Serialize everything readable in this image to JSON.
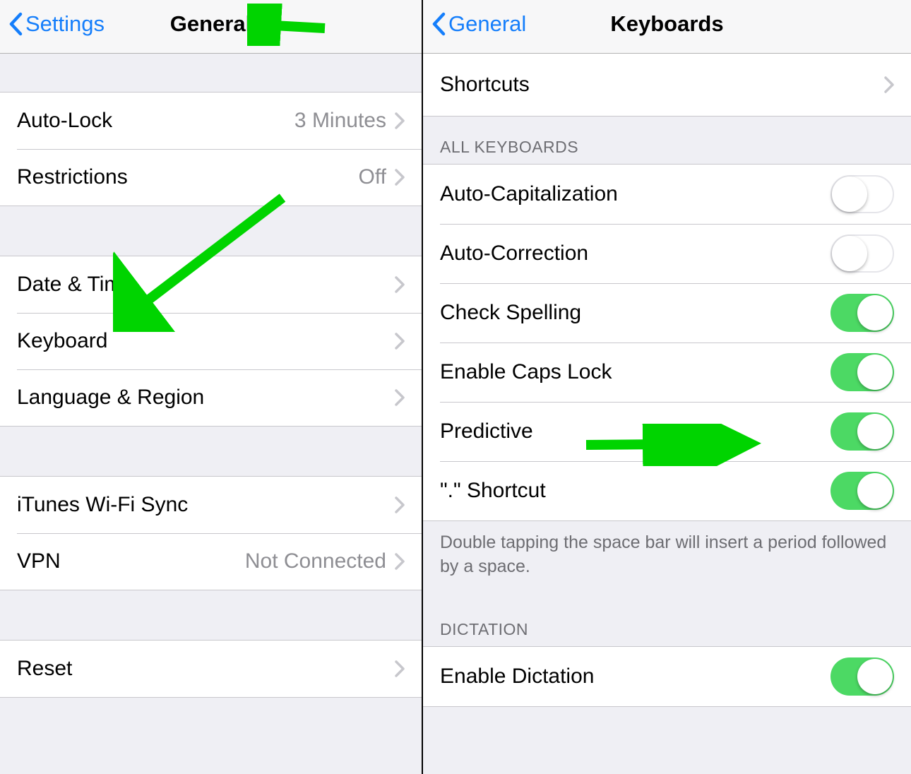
{
  "left": {
    "back_label": "Settings",
    "title": "General",
    "group1": {
      "auto_lock": {
        "label": "Auto-Lock",
        "value": "3 Minutes"
      },
      "restrictions": {
        "label": "Restrictions",
        "value": "Off"
      }
    },
    "group2": {
      "date_time": {
        "label": "Date & Time"
      },
      "keyboard": {
        "label": "Keyboard"
      },
      "language_region": {
        "label": "Language & Region"
      }
    },
    "group3": {
      "itunes_wifi": {
        "label": "iTunes Wi-Fi Sync"
      },
      "vpn": {
        "label": "VPN",
        "value": "Not Connected"
      }
    },
    "group4": {
      "reset": {
        "label": "Reset"
      }
    }
  },
  "right": {
    "back_label": "General",
    "title": "Keyboards",
    "group0": {
      "shortcuts": {
        "label": "Shortcuts"
      }
    },
    "section_all_header": "ALL KEYBOARDS",
    "group1": {
      "auto_cap": {
        "label": "Auto-Capitalization",
        "on": false
      },
      "auto_corr": {
        "label": "Auto-Correction",
        "on": false
      },
      "check_spell": {
        "label": "Check Spelling",
        "on": true
      },
      "caps_lock": {
        "label": "Enable Caps Lock",
        "on": true
      },
      "predictive": {
        "label": "Predictive",
        "on": true
      },
      "period_shortcut": {
        "label": "\".\" Shortcut",
        "on": true
      }
    },
    "footer_period": "Double tapping the space bar will insert a period followed by a space.",
    "section_dictation_header": "DICTATION",
    "group2": {
      "enable_dictation": {
        "label": "Enable Dictation",
        "on": true
      }
    }
  },
  "colors": {
    "accent": "#157efb",
    "toggle_on": "#4cd964",
    "arrow": "#00d400"
  }
}
